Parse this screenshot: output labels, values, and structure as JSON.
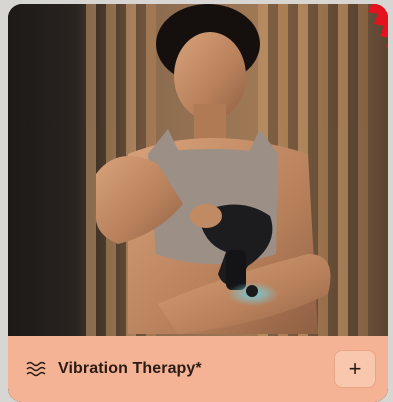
{
  "card": {
    "title": "Vibration Therapy*",
    "add_symbol": "+",
    "photo_subject": "woman using massage gun on forearm",
    "wave_icon": "vibration-waves-icon",
    "badge_icon": "red-starburst-badge-icon"
  },
  "colors": {
    "bar_background": "#f4b394",
    "button_background": "#f8c7ad",
    "text": "#2a1c14",
    "badge": "#e3121e"
  }
}
